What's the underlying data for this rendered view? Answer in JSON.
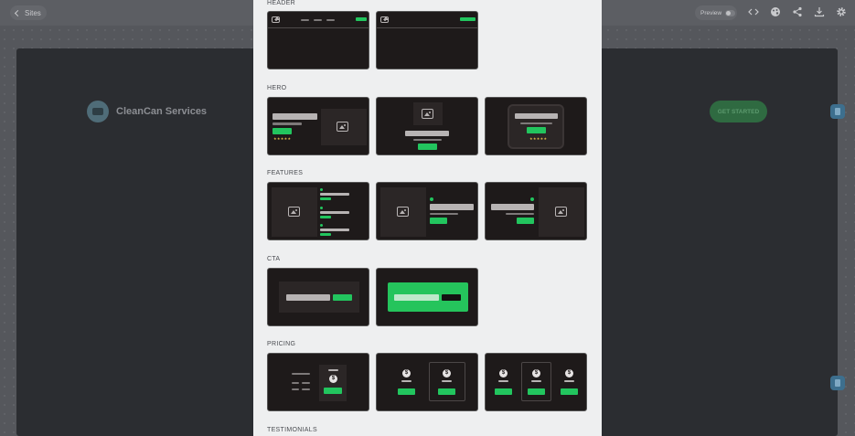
{
  "topbar": {
    "sites_label": "Sites",
    "preview_label": "Preview",
    "icons": [
      "code-icon",
      "palette-icon",
      "share-icon",
      "download-icon",
      "gear-icon"
    ]
  },
  "site": {
    "brand_name": "CleanCan Services",
    "cta_label": "GET STARTED"
  },
  "modal": {
    "sections": [
      {
        "label": "HEADER",
        "variants": 2
      },
      {
        "label": "HERO",
        "variants": 3
      },
      {
        "label": "FEATURES",
        "variants": 3
      },
      {
        "label": "CTA",
        "variants": 2
      },
      {
        "label": "PRICING",
        "variants": 3
      },
      {
        "label": "TESTIMONIALS",
        "variants": 0
      }
    ],
    "currency_symbol": "$",
    "stars": "★★★★★"
  },
  "colors": {
    "accent": "#22c55e",
    "card_bg": "#1e1a1a",
    "modal_bg": "#eeeff0",
    "backdrop": "#56585d"
  }
}
